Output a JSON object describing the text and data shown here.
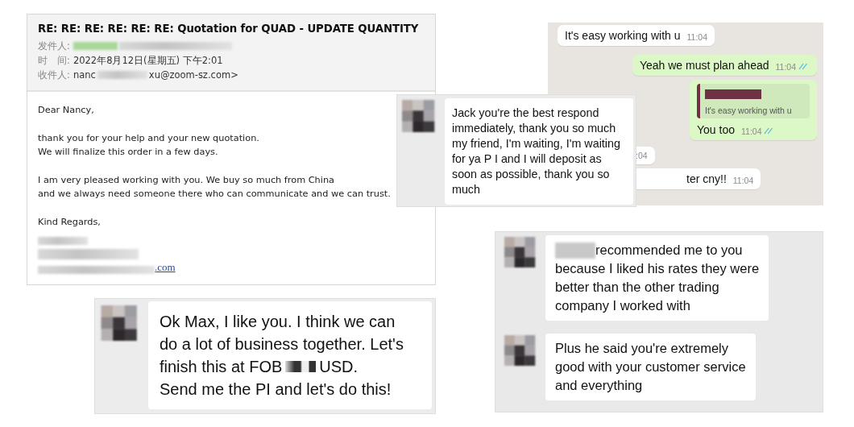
{
  "email": {
    "subject": "RE: RE: RE: RE: RE: RE: Quotation for QUAD - UPDATE QUANTITY",
    "meta": [
      {
        "label": "发件人:",
        "parts": [
          {
            "kind": "highlight"
          },
          {
            "kind": "redacted"
          }
        ]
      },
      {
        "label": "时　间:",
        "parts": [
          {
            "kind": "text",
            "text": "2022年8月12日(星期五) 下午2:01"
          }
        ]
      },
      {
        "label": "收件人:",
        "parts": [
          {
            "kind": "text",
            "text": "nanc"
          },
          {
            "kind": "redacted"
          },
          {
            "kind": "text",
            "text": "xu@zoom-sz.com>"
          }
        ]
      }
    ],
    "paragraphs": [
      "Dear Nancy,",
      "thank you for your help and your new quotation.\nWe will finalize this order in a few days.",
      "I am very pleased working with you. We buy so much from China\nand we always need someone there who can communicate and we can trust.",
      "Kind Regards,"
    ],
    "signature": [
      [
        {
          "kind": "redacted"
        }
      ],
      [
        {
          "kind": "redacted"
        }
      ],
      [
        {
          "kind": "redacted"
        },
        {
          "kind": "link",
          "text": ".com"
        }
      ]
    ]
  },
  "whatsapp": {
    "messages": [
      {
        "kind": "incoming",
        "text": "It's easy working with u",
        "time": "11:04",
        "read": false
      },
      {
        "kind": "outgoing",
        "text": "Yeah we must plan ahead",
        "time": "11:04",
        "read": true
      },
      {
        "kind": "outgoing",
        "quote": "It's easy working with u",
        "text": "You too",
        "time": "11:04",
        "read": true
      },
      {
        "kind": "incoming",
        "time": ":04",
        "read": false
      },
      {
        "kind": "incoming",
        "text": "ter cny!!",
        "time": "11:04",
        "read": false
      }
    ]
  },
  "chat_cards": [
    {
      "messages": [
        {
          "lines": [
            [
              {
                "kind": "text",
                "text": "Jack you're the best respond"
              }
            ],
            [
              {
                "kind": "text",
                "text": "immediately, thank you so much"
              }
            ],
            [
              {
                "kind": "text",
                "text": "my friend, I'm waiting, I'm waiting"
              }
            ],
            [
              {
                "kind": "text",
                "text": "for ya P I and I will deposit as"
              }
            ],
            [
              {
                "kind": "text",
                "text": "soon as possible, thank you so"
              }
            ],
            [
              {
                "kind": "text",
                "text": "much"
              }
            ]
          ]
        }
      ]
    },
    {
      "messages": [
        {
          "lines": [
            [
              {
                "kind": "text",
                "text": "Ok Max, I like you. I think we can"
              }
            ],
            [
              {
                "kind": "text",
                "text": "do a lot of business together. Let's"
              }
            ],
            [
              {
                "kind": "text",
                "text": "finish this at FOB"
              },
              {
                "kind": "redacted"
              },
              {
                "kind": "text",
                "text": "USD."
              }
            ],
            [
              {
                "kind": "text",
                "text": "Send me the PI and let's do this!"
              }
            ]
          ]
        }
      ]
    },
    {
      "messages": [
        {
          "lines": [
            [
              {
                "kind": "redacted"
              },
              {
                "kind": "text",
                "text": "recommended me to you"
              }
            ],
            [
              {
                "kind": "text",
                "text": "because I liked his rates they were"
              }
            ],
            [
              {
                "kind": "text",
                "text": "better than the other trading"
              }
            ],
            [
              {
                "kind": "text",
                "text": "company I worked with"
              }
            ]
          ]
        },
        {
          "lines": [
            [
              {
                "kind": "text",
                "text": "Plus he said you're extremely"
              }
            ],
            [
              {
                "kind": "text",
                "text": "good with your customer service"
              }
            ],
            [
              {
                "kind": "text",
                "text": "and everything"
              }
            ]
          ]
        }
      ]
    }
  ]
}
